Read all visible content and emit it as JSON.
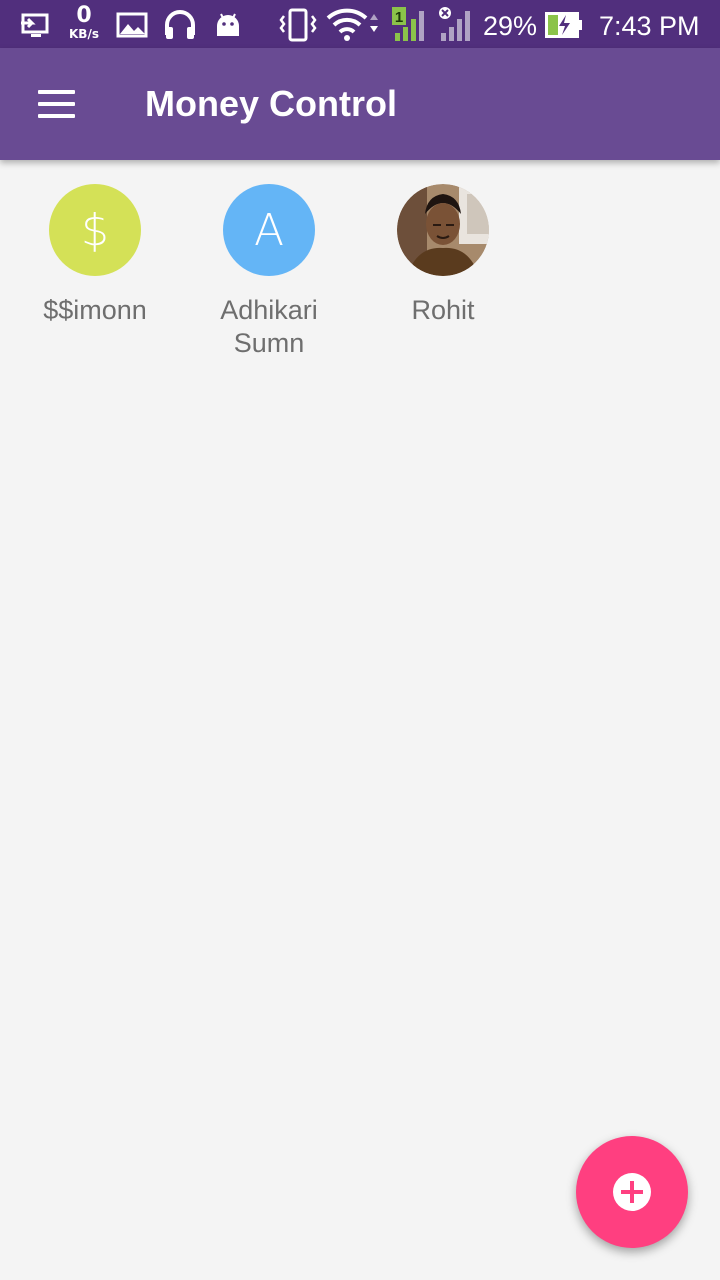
{
  "status_bar": {
    "speed_value": "0",
    "speed_unit": "KB/s",
    "battery_percent": "29%",
    "time": "7:43 PM",
    "sim_label": "1",
    "icons": [
      "cast-icon",
      "image-icon",
      "headset-icon",
      "android-icon",
      "vibrate-icon",
      "wifi-icon",
      "signal-sim1-icon",
      "signal-sim2-icon",
      "battery-charging-icon"
    ]
  },
  "app_bar": {
    "title": "Money Control",
    "menu_icon": "hamburger-menu-icon"
  },
  "contacts": [
    {
      "name": "$$imonn",
      "initial": "$",
      "color": "#d4e157"
    },
    {
      "name": "Adhikari Sumn",
      "initial": "A",
      "color": "#64b5f6"
    },
    {
      "name": "Rohit",
      "initial": "",
      "photo": true
    }
  ],
  "fab": {
    "icon": "add-circle-icon",
    "color": "#ff3f80"
  },
  "colors": {
    "status_bar": "#512f7d",
    "app_bar": "#694b93",
    "background": "#f4f4f4"
  }
}
